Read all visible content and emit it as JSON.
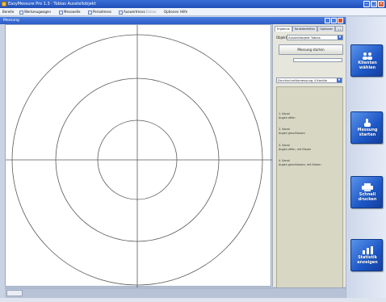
{
  "app": {
    "title": "EasyMessure Pro 1.3 · Tobias Ausstellobjekt",
    "window_title": "Messung"
  },
  "menu": {
    "items": [
      "Bereite",
      "Werkzeugwagen",
      "Messwelle",
      "Periodmess",
      "Auswertmess",
      "Extras",
      "Optionen",
      "Hilfe"
    ]
  },
  "panel": {
    "tabs": [
      "Ergebnis",
      "Tonleiterhilfen",
      "Optionen"
    ],
    "object_label": "Objekt",
    "object_value": "Ausstellobjekt Tobias",
    "measure_button": "Messung starten",
    "progress": 0.0,
    "variant_value": "Durchschnittsmessung 4 Kanäle",
    "list": [
      {
        "title": "1. Kanal",
        "detail": "Augen offen"
      },
      {
        "title": "2. Kanal",
        "detail": "Augen geschlossen"
      },
      {
        "title": "3. Kanal",
        "detail": "Augen offen, mit Kissen"
      },
      {
        "title": "4. Kanal",
        "detail": "Augen geschlossen, mit Kissen"
      }
    ]
  },
  "sidebar": {
    "buttons": [
      {
        "label_1": "Klienten",
        "label_2": "wählen"
      },
      {
        "label_1": "Messung",
        "label_2": "starten"
      },
      {
        "label_1": "Schnell",
        "label_2": "drucken"
      },
      {
        "label_1": "Statistik",
        "label_2": "anzeigen"
      }
    ]
  },
  "icons": {
    "minimize": "minimize-icon",
    "maximize": "maximize-icon",
    "close": "close-icon",
    "dropdown": "chevron-down-icon"
  },
  "colors": {
    "titlebar": "#2b5cc4",
    "accent_button": "#1d57c6",
    "panel_list_bg": "#d7d7c4",
    "canvas_bg": "#ffffff"
  }
}
